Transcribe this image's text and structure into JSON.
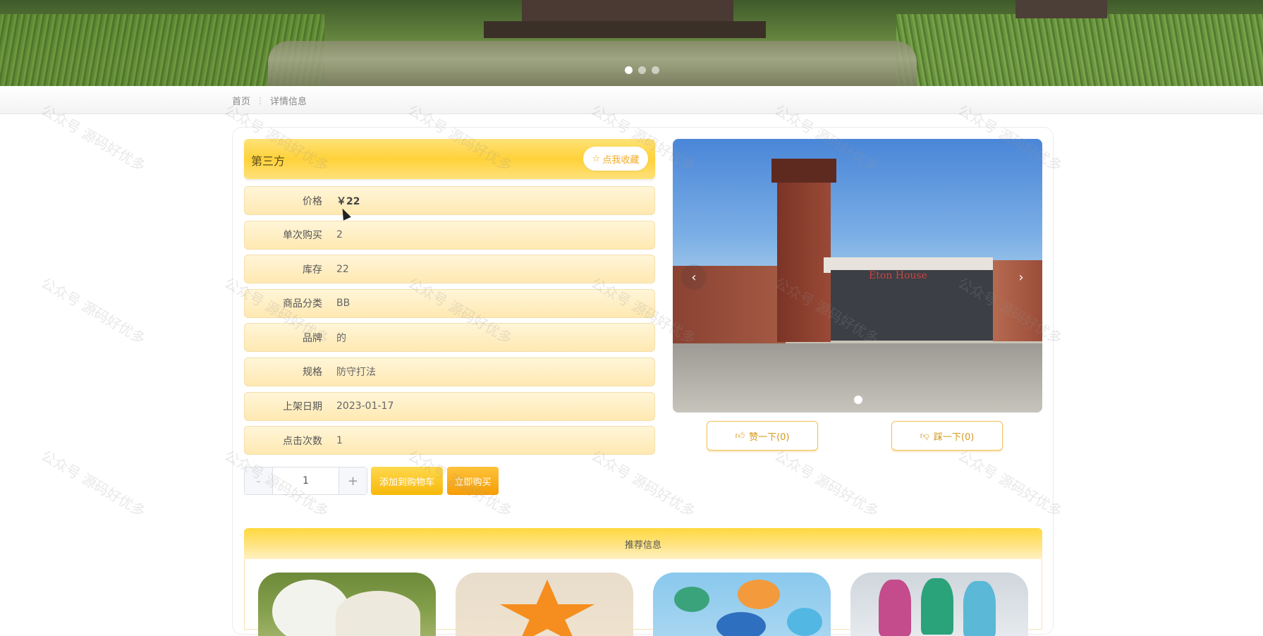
{
  "banner": {
    "slides": 3,
    "active_slide": 1
  },
  "breadcrumb": {
    "home": "首页",
    "current": "详情信息"
  },
  "product": {
    "title": "第三方",
    "favorite_label": "点我收藏",
    "favorite_icon": "star-outline-icon",
    "fields": [
      {
        "label": "价格",
        "value": "￥22"
      },
      {
        "label": "单次购买",
        "value": "2"
      },
      {
        "label": "库存",
        "value": "22"
      },
      {
        "label": "商品分类",
        "value": "BB"
      },
      {
        "label": "品牌",
        "value": "的"
      },
      {
        "label": "规格",
        "value": "防守打法"
      },
      {
        "label": "上架日期",
        "value": "2023-01-17"
      },
      {
        "label": "点击次数",
        "value": "1"
      }
    ]
  },
  "quantity": {
    "value": "1",
    "minus": "-",
    "plus": "+"
  },
  "actions": {
    "add_to_cart": "添加到购物车",
    "buy_now": "立即购买"
  },
  "gallery": {
    "sign_text": "Eton House",
    "prev": "‹",
    "next": "›"
  },
  "votes": {
    "up_label": "赞一下(0)",
    "down_label": "踩一下(0)"
  },
  "recommend": {
    "title": "推荐信息"
  },
  "watermark": {
    "text": "公众号 源码好优多"
  },
  "colors": {
    "accent": "#ffd23a",
    "accent_dark": "#f59d07",
    "vote_text": "#d49a1d"
  }
}
